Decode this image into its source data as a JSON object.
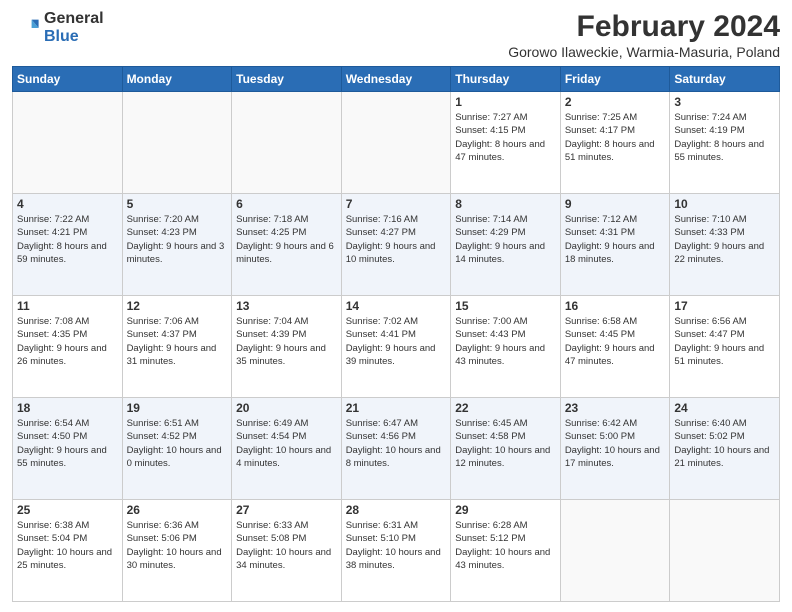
{
  "logo": {
    "general": "General",
    "blue": "Blue"
  },
  "title": "February 2024",
  "subtitle": "Gorowo Ilaweckie, Warmia-Masuria, Poland",
  "days_of_week": [
    "Sunday",
    "Monday",
    "Tuesday",
    "Wednesday",
    "Thursday",
    "Friday",
    "Saturday"
  ],
  "weeks": [
    [
      {
        "day": "",
        "info": ""
      },
      {
        "day": "",
        "info": ""
      },
      {
        "day": "",
        "info": ""
      },
      {
        "day": "",
        "info": ""
      },
      {
        "day": "1",
        "info": "Sunrise: 7:27 AM\nSunset: 4:15 PM\nDaylight: 8 hours and 47 minutes."
      },
      {
        "day": "2",
        "info": "Sunrise: 7:25 AM\nSunset: 4:17 PM\nDaylight: 8 hours and 51 minutes."
      },
      {
        "day": "3",
        "info": "Sunrise: 7:24 AM\nSunset: 4:19 PM\nDaylight: 8 hours and 55 minutes."
      }
    ],
    [
      {
        "day": "4",
        "info": "Sunrise: 7:22 AM\nSunset: 4:21 PM\nDaylight: 8 hours and 59 minutes."
      },
      {
        "day": "5",
        "info": "Sunrise: 7:20 AM\nSunset: 4:23 PM\nDaylight: 9 hours and 3 minutes."
      },
      {
        "day": "6",
        "info": "Sunrise: 7:18 AM\nSunset: 4:25 PM\nDaylight: 9 hours and 6 minutes."
      },
      {
        "day": "7",
        "info": "Sunrise: 7:16 AM\nSunset: 4:27 PM\nDaylight: 9 hours and 10 minutes."
      },
      {
        "day": "8",
        "info": "Sunrise: 7:14 AM\nSunset: 4:29 PM\nDaylight: 9 hours and 14 minutes."
      },
      {
        "day": "9",
        "info": "Sunrise: 7:12 AM\nSunset: 4:31 PM\nDaylight: 9 hours and 18 minutes."
      },
      {
        "day": "10",
        "info": "Sunrise: 7:10 AM\nSunset: 4:33 PM\nDaylight: 9 hours and 22 minutes."
      }
    ],
    [
      {
        "day": "11",
        "info": "Sunrise: 7:08 AM\nSunset: 4:35 PM\nDaylight: 9 hours and 26 minutes."
      },
      {
        "day": "12",
        "info": "Sunrise: 7:06 AM\nSunset: 4:37 PM\nDaylight: 9 hours and 31 minutes."
      },
      {
        "day": "13",
        "info": "Sunrise: 7:04 AM\nSunset: 4:39 PM\nDaylight: 9 hours and 35 minutes."
      },
      {
        "day": "14",
        "info": "Sunrise: 7:02 AM\nSunset: 4:41 PM\nDaylight: 9 hours and 39 minutes."
      },
      {
        "day": "15",
        "info": "Sunrise: 7:00 AM\nSunset: 4:43 PM\nDaylight: 9 hours and 43 minutes."
      },
      {
        "day": "16",
        "info": "Sunrise: 6:58 AM\nSunset: 4:45 PM\nDaylight: 9 hours and 47 minutes."
      },
      {
        "day": "17",
        "info": "Sunrise: 6:56 AM\nSunset: 4:47 PM\nDaylight: 9 hours and 51 minutes."
      }
    ],
    [
      {
        "day": "18",
        "info": "Sunrise: 6:54 AM\nSunset: 4:50 PM\nDaylight: 9 hours and 55 minutes."
      },
      {
        "day": "19",
        "info": "Sunrise: 6:51 AM\nSunset: 4:52 PM\nDaylight: 10 hours and 0 minutes."
      },
      {
        "day": "20",
        "info": "Sunrise: 6:49 AM\nSunset: 4:54 PM\nDaylight: 10 hours and 4 minutes."
      },
      {
        "day": "21",
        "info": "Sunrise: 6:47 AM\nSunset: 4:56 PM\nDaylight: 10 hours and 8 minutes."
      },
      {
        "day": "22",
        "info": "Sunrise: 6:45 AM\nSunset: 4:58 PM\nDaylight: 10 hours and 12 minutes."
      },
      {
        "day": "23",
        "info": "Sunrise: 6:42 AM\nSunset: 5:00 PM\nDaylight: 10 hours and 17 minutes."
      },
      {
        "day": "24",
        "info": "Sunrise: 6:40 AM\nSunset: 5:02 PM\nDaylight: 10 hours and 21 minutes."
      }
    ],
    [
      {
        "day": "25",
        "info": "Sunrise: 6:38 AM\nSunset: 5:04 PM\nDaylight: 10 hours and 25 minutes."
      },
      {
        "day": "26",
        "info": "Sunrise: 6:36 AM\nSunset: 5:06 PM\nDaylight: 10 hours and 30 minutes."
      },
      {
        "day": "27",
        "info": "Sunrise: 6:33 AM\nSunset: 5:08 PM\nDaylight: 10 hours and 34 minutes."
      },
      {
        "day": "28",
        "info": "Sunrise: 6:31 AM\nSunset: 5:10 PM\nDaylight: 10 hours and 38 minutes."
      },
      {
        "day": "29",
        "info": "Sunrise: 6:28 AM\nSunset: 5:12 PM\nDaylight: 10 hours and 43 minutes."
      },
      {
        "day": "",
        "info": ""
      },
      {
        "day": "",
        "info": ""
      }
    ]
  ]
}
